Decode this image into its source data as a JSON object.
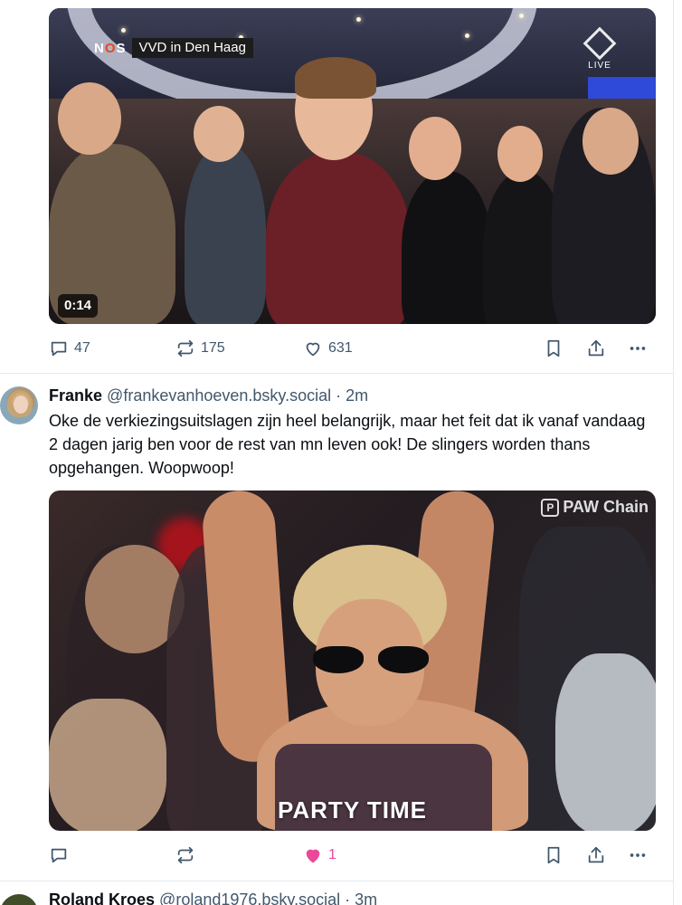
{
  "colors": {
    "text": "#0b0f14",
    "muted": "#42576c",
    "like_pink": "#ec4899",
    "divider": "#e5e9ee"
  },
  "video_post": {
    "overlay": {
      "channel_logo": "NOS",
      "banner": "VVD in Den Haag",
      "live_badge": "LIVE"
    },
    "duration": "0:14",
    "actions": {
      "reply_icon": "reply-icon",
      "reply_count": "47",
      "repost_icon": "repost-icon",
      "repost_count": "175",
      "like_icon": "heart-outline-icon",
      "like_count": "631",
      "bookmark_icon": "bookmark-icon",
      "share_icon": "share-icon",
      "more_icon": "more-icon"
    }
  },
  "franke_post": {
    "name": "Franke",
    "handle": "@frankevanhoeven.bsky.social",
    "separator": "·",
    "time": "2m",
    "text": "Oke de verkiezingsuitslagen zijn heel belangrijk, maar het feit dat ik vanaf vandaag 2 dagen jarig ben voor de rest van mn leven ook! De slingers worden thans opgehangen. Woopwoop!",
    "gif": {
      "watermark": "PAW Chain",
      "caption": "PARTY TIME"
    },
    "actions": {
      "reply_count": "",
      "repost_count": "",
      "like_count": "1",
      "liked": true
    }
  },
  "roland_post": {
    "name": "Roland Kroes",
    "handle": "@roland1976.bsky.social",
    "separator": "·",
    "time": "3m"
  }
}
